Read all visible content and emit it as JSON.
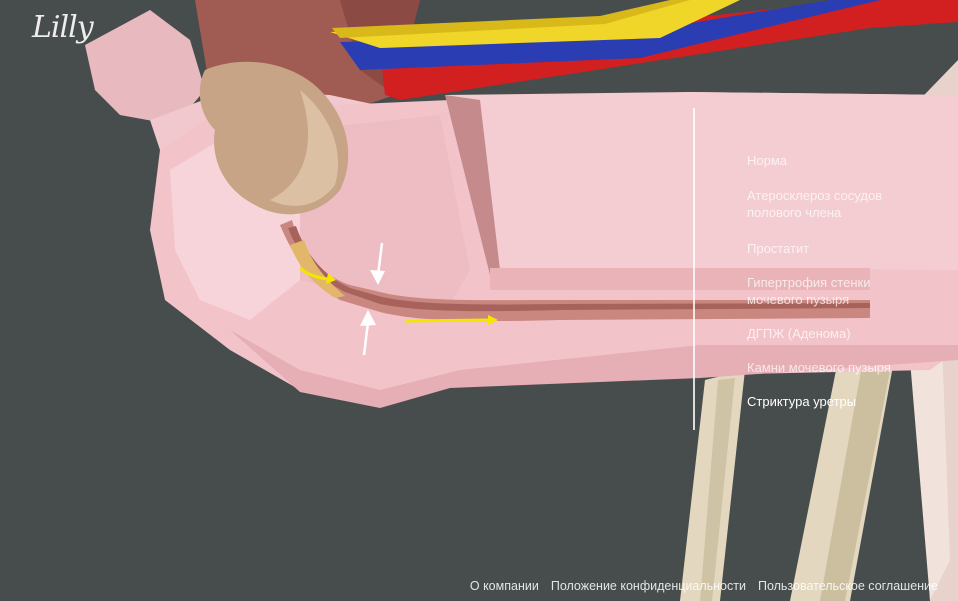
{
  "brand": {
    "logo_text": "Lilly"
  },
  "menu": {
    "items": [
      {
        "label": "Норма",
        "active": false
      },
      {
        "label": "Атеросклероз сосудов полового члена",
        "active": false
      },
      {
        "label": "Простатит",
        "active": false
      },
      {
        "label": "Гипертрофия стенки мочевого пузыря",
        "active": false
      },
      {
        "label": "ДГПЖ (Аденома)",
        "active": false
      },
      {
        "label": "Камни мочевого пузыря",
        "active": false
      },
      {
        "label": "Стриктура уретры",
        "active": true
      }
    ]
  },
  "footer": {
    "links": [
      {
        "label": "О компании"
      },
      {
        "label": "Положение конфиденциальности"
      },
      {
        "label": "Пользовательское соглашение"
      }
    ]
  },
  "colors": {
    "background": "#474d4c",
    "tissue": "#f2c2c9",
    "artery": "#d42020",
    "vein": "#2b3fb5",
    "nerve": "#f2d72a",
    "bone": "#e6dcc4",
    "prostate": "#c9a98a",
    "arrow_flow": "#f5e600"
  },
  "icons": {
    "logo": "lilly-logo",
    "flow_arrow": "yellow-arrow-icon",
    "constriction_arrow": "white-arrow-icon"
  }
}
